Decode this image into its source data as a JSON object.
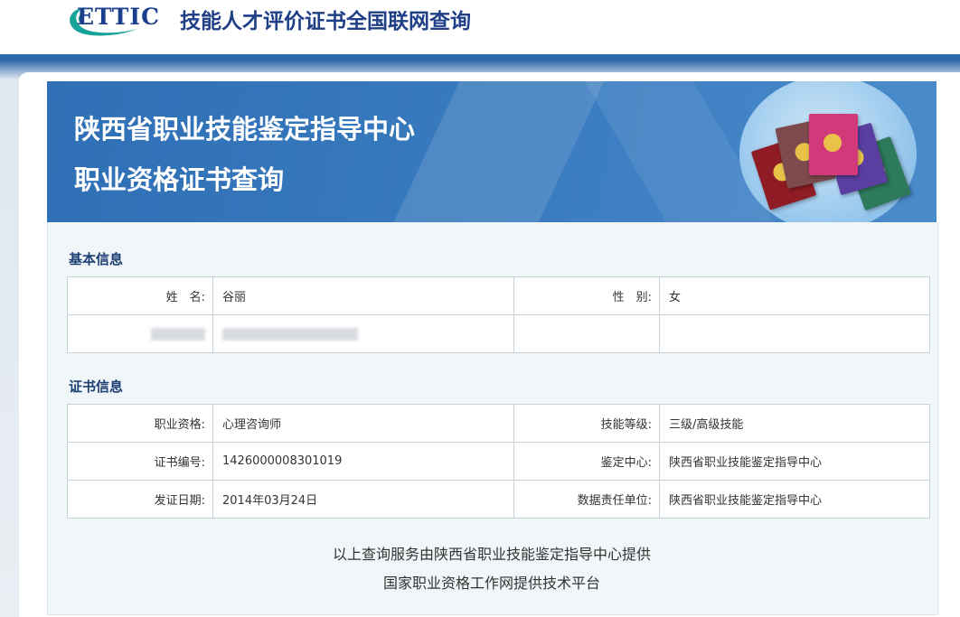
{
  "header": {
    "logo_text": "ETTIC",
    "site_title": "技能人才评价证书全国联网查询"
  },
  "banner": {
    "line1": "陕西省职业技能鉴定指导中心",
    "line2": "职业资格证书查询",
    "book_colors": [
      "#8f1c24",
      "#7d4a4d",
      "#d2397a",
      "#5a3fa0",
      "#2e7a5d"
    ]
  },
  "basic_info": {
    "title": "基本信息",
    "name_label": "姓　名:",
    "name_value": "谷丽",
    "gender_label": "性　别:",
    "gender_value": "女"
  },
  "cert_info": {
    "title": "证书信息",
    "rows": [
      {
        "l1": "职业资格:",
        "v1": "心理咨询师",
        "l2": "技能等级:",
        "v2": "三级/高级技能"
      },
      {
        "l1": "证书编号:",
        "v1": "1426000008301019",
        "l2": "鉴定中心:",
        "v2": "陕西省职业技能鉴定指导中心"
      },
      {
        "l1": "发证日期:",
        "v1": "2014年03月24日",
        "l2": "数据责任单位:",
        "v2": "陕西省职业技能鉴定指导中心"
      }
    ]
  },
  "footer": {
    "line1": "以上查询服务由陕西省职业技能鉴定指导中心提供",
    "line2": "国家职业资格工作网提供技术平台"
  },
  "colors": {
    "banner_blue": "#2f6fb5",
    "title_navy": "#1f3f86",
    "logo_teal": "#16a39a"
  }
}
